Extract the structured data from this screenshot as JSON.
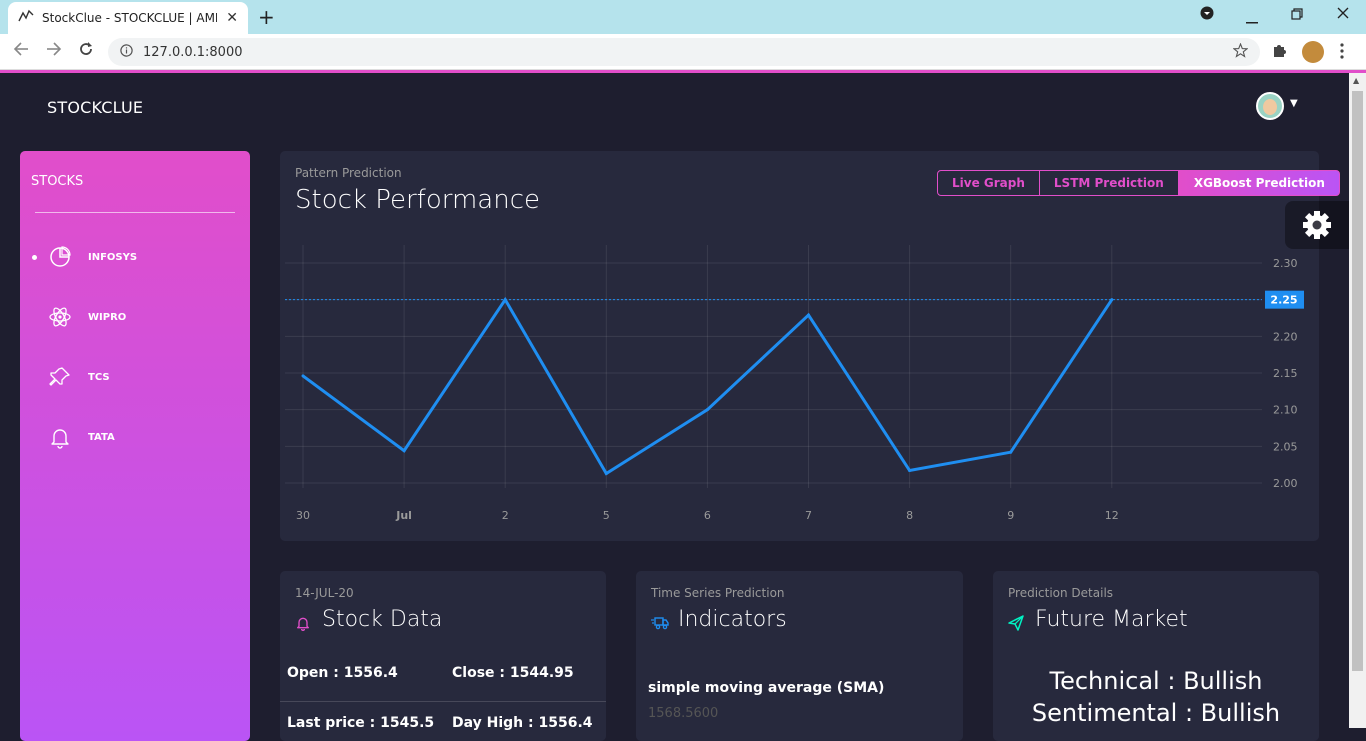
{
  "browser": {
    "tab_title": "StockClue - STOCKCLUE | AMPro",
    "tab_close": "✕",
    "new_tab": "+",
    "url": "127.0.0.1:8000"
  },
  "app": {
    "brand": "STOCKCLUE"
  },
  "sidebar": {
    "title": "STOCKS",
    "items": [
      {
        "label": "INFOSYS",
        "icon": "pie-chart-icon",
        "active": true
      },
      {
        "label": "WIPRO",
        "icon": "atom-icon",
        "active": false
      },
      {
        "label": "TCS",
        "icon": "pin-icon",
        "active": false
      },
      {
        "label": "TATA",
        "icon": "bell-icon",
        "active": false
      }
    ]
  },
  "main_card": {
    "category": "Pattern Prediction",
    "title": "Stock Performance",
    "buttons": [
      {
        "label": "Live Graph",
        "active": false
      },
      {
        "label": "LSTM Prediction",
        "active": false
      },
      {
        "label": "XGBoost Prediction",
        "active": true
      }
    ]
  },
  "chart_data": {
    "type": "line",
    "x": [
      "30",
      "Jul",
      "2",
      "5",
      "6",
      "7",
      "8",
      "9",
      "12"
    ],
    "values": [
      2.146,
      2.044,
      2.25,
      2.013,
      2.1,
      2.229,
      2.017,
      2.042,
      2.25
    ],
    "y_ticks": [
      "2.30",
      "2.25",
      "2.20",
      "2.15",
      "2.10",
      "2.05",
      "2.00"
    ],
    "ylim": [
      2.0,
      2.3
    ],
    "current_value_label": "2.25",
    "line_color": "#1f8ef1",
    "grid": true,
    "y_axis_position": "right"
  },
  "stock_data": {
    "date": "14-JUL-20",
    "title": "Stock Data",
    "open": "Open : 1556.4",
    "close": "Close : 1544.95",
    "last_price": "Last price : 1545.5",
    "day_high": "Day High : 1556.4"
  },
  "indicators": {
    "category": "Time Series Prediction",
    "title": "Indicators",
    "sma_label": "simple moving average (SMA)",
    "sma_value": "1568.5600"
  },
  "future_market": {
    "category": "Prediction Details",
    "title": "Future Market",
    "technical": "Technical : Bullish",
    "sentimental": "Sentimental : Bullish"
  },
  "colors": {
    "primary": "#e14eca",
    "secondary": "#ba54f5",
    "background": "#1e1e2f",
    "card": "#27293d",
    "line": "#1f8ef1",
    "future_icon": "#00f2c3"
  }
}
